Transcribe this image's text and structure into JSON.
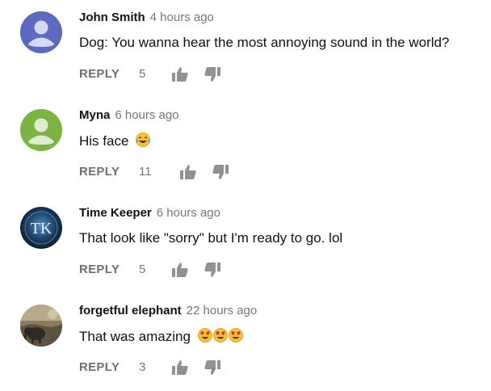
{
  "comments": [
    {
      "author": "John Smith",
      "time": "4 hours ago",
      "text": "Dog: You wanna hear the most annoying sound in the world?",
      "reply_label": "REPLY",
      "likes": "5",
      "avatar": "default-avatar-blue",
      "avatar_color": "#5c6bc0"
    },
    {
      "author": "Myna",
      "time": "6 hours ago",
      "text": "His face",
      "emoji": "face-with-tears-of-joy",
      "reply_label": "REPLY",
      "likes": "11",
      "avatar": "default-avatar-green",
      "avatar_color": "#7cb342"
    },
    {
      "author": "Time Keeper",
      "time": "6 hours ago",
      "text": "That look like \"sorry\" but I'm ready to go. lol",
      "reply_label": "REPLY",
      "likes": "5",
      "avatar": "tk-logo-avatar",
      "avatar_letters": "TK"
    },
    {
      "author": "forgetful elephant",
      "time": "22 hours ago",
      "text": "That was amazing",
      "emoji": "smiling-face-with-heart-eyes-x3",
      "reply_label": "REPLY",
      "likes": "3",
      "avatar": "photo-avatar-elephant"
    }
  ]
}
